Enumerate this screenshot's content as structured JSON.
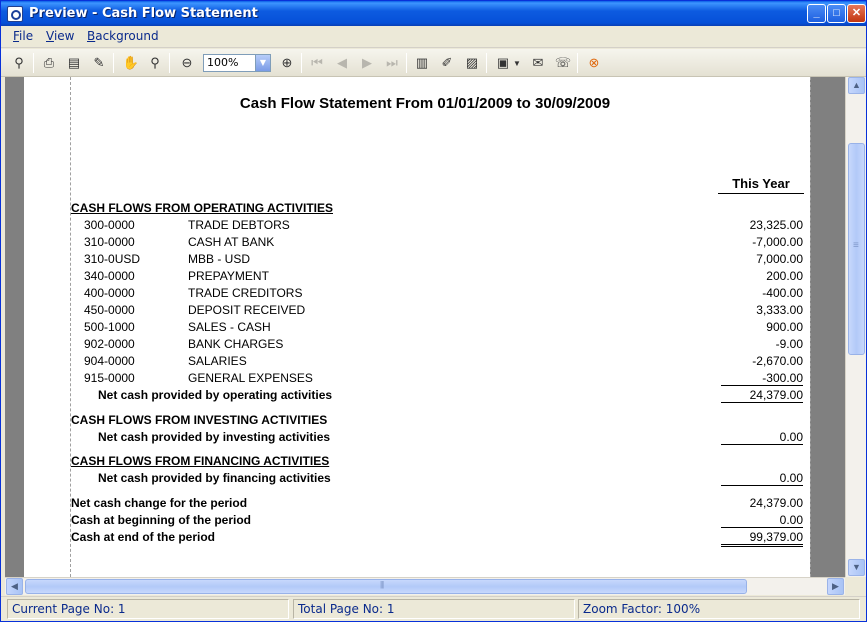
{
  "window": {
    "title": "Preview - Cash Flow Statement"
  },
  "menu": {
    "file": {
      "first": "F",
      "rest": "ile"
    },
    "view": {
      "first": "V",
      "rest": "iew"
    },
    "background": {
      "first": "B",
      "rest": "ackground"
    }
  },
  "toolbar": {
    "zoom_value": "100%"
  },
  "report": {
    "title": "Cash Flow Statement From 01/01/2009 to 30/09/2009",
    "column_header": "This Year",
    "operating": {
      "heading": "CASH FLOWS FROM OPERATING ACTIVITIES",
      "rows": [
        {
          "code": "300-0000",
          "name": "TRADE DEBTORS",
          "amount": "23,325.00"
        },
        {
          "code": "310-0000",
          "name": "CASH AT BANK",
          "amount": "-7,000.00"
        },
        {
          "code": "310-0USD",
          "name": "MBB - USD",
          "amount": "7,000.00"
        },
        {
          "code": "340-0000",
          "name": "PREPAYMENT",
          "amount": "200.00"
        },
        {
          "code": "400-0000",
          "name": "TRADE CREDITORS",
          "amount": "-400.00"
        },
        {
          "code": "450-0000",
          "name": "DEPOSIT RECEIVED",
          "amount": "3,333.00"
        },
        {
          "code": "500-1000",
          "name": "SALES - CASH",
          "amount": "900.00"
        },
        {
          "code": "902-0000",
          "name": "BANK CHARGES",
          "amount": "-9.00"
        },
        {
          "code": "904-0000",
          "name": "SALARIES",
          "amount": "-2,670.00"
        },
        {
          "code": "915-0000",
          "name": "GENERAL EXPENSES",
          "amount": "-300.00"
        }
      ],
      "total_label": "Net cash provided by operating activities",
      "total": "24,379.00"
    },
    "investing": {
      "heading": "CASH FLOWS FROM INVESTING ACTIVITIES",
      "total_label": "Net cash provided by investing activities",
      "total": "0.00"
    },
    "financing": {
      "heading": "CASH FLOWS FROM FINANCING ACTIVITIES",
      "total_label": "Net cash provided by financing activities",
      "total": "0.00"
    },
    "summary": [
      {
        "label": "Net cash change for the period",
        "amount": "24,379.00"
      },
      {
        "label": "Cash at beginning of the period",
        "amount": "0.00"
      },
      {
        "label": "Cash at end of the period",
        "amount": "99,379.00"
      }
    ]
  },
  "status": {
    "current_page": "Current Page No: 1",
    "total_page": "Total Page No: 1",
    "zoom_factor": "Zoom Factor: 100%"
  }
}
